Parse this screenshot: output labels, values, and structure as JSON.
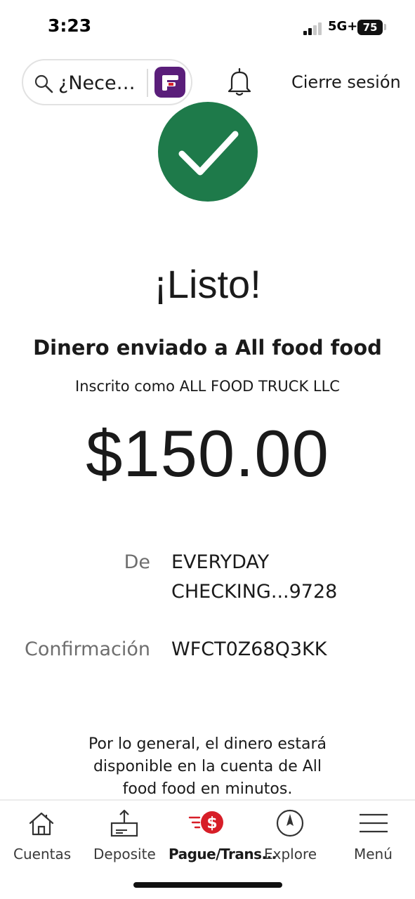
{
  "status_bar": {
    "time": "3:23",
    "network": "5G+",
    "battery": "75"
  },
  "header": {
    "search_placeholder": "¿Nece…",
    "signout_label": "Cierre sesión",
    "icons": [
      "search-icon",
      "fargo-assistant-icon",
      "bell-icon"
    ]
  },
  "confirmation": {
    "title": "¡Listo!",
    "subtitle": "Dinero enviado a All food food",
    "enrolled_as": "Inscrito como ALL FOOD TRUCK LLC",
    "amount": "$150.00",
    "from_label": "De",
    "from_value": "EVERYDAY CHECKING...9728",
    "confirmation_label": "Confirmación",
    "confirmation_value": "WFCT0Z68Q3KK",
    "note": "Por lo general, el dinero estará disponible en la cuenta de All food food en minutos."
  },
  "bottom_nav": {
    "items": [
      {
        "label": "Cuentas",
        "icon": "home-icon"
      },
      {
        "label": "Deposite",
        "icon": "deposit-icon"
      },
      {
        "label": "Pague/Trans...",
        "icon": "pay-transfer-icon"
      },
      {
        "label": "Explore",
        "icon": "compass-icon"
      },
      {
        "label": "Menú",
        "icon": "menu-icon"
      }
    ]
  },
  "colors": {
    "success_green": "#1e7a4a",
    "brand_red": "#d71e28",
    "fargo_purple": "#5a1e7a"
  }
}
